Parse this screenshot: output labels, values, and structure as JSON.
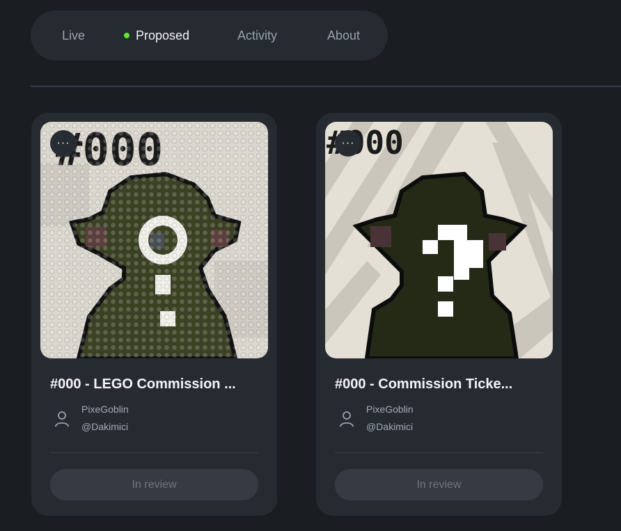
{
  "tabs": [
    {
      "label": "Live",
      "active": false
    },
    {
      "label": "Proposed",
      "active": true,
      "indicator_color": "#5fe52d"
    },
    {
      "label": "Activity",
      "active": false
    },
    {
      "label": "About",
      "active": false
    }
  ],
  "cards": [
    {
      "title": "#000 - LEGO Commission ...",
      "artwork_text": "#000",
      "menu_label": "···",
      "creator_name": "PixeGoblin",
      "creator_handle": "@Dakimici",
      "status_label": "In review"
    },
    {
      "title": "#000 - Commission Ticke...",
      "artwork_text": "#000",
      "menu_label": "···",
      "creator_name": "PixeGoblin",
      "creator_handle": "@Dakimici",
      "status_label": "In review"
    }
  ],
  "colors": {
    "background": "#1a1d22",
    "surface": "#262b32",
    "accent": "#5fe52d"
  }
}
